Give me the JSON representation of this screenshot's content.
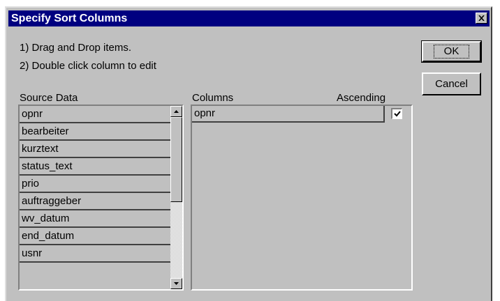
{
  "dialog": {
    "title": "Specify Sort Columns",
    "close_icon": "close-icon"
  },
  "instructions": {
    "line1": "1) Drag and Drop items.",
    "line2": "2) Double click column to edit"
  },
  "buttons": {
    "ok": "OK",
    "cancel": "Cancel"
  },
  "source": {
    "label": "Source Data",
    "items": [
      "opnr",
      "bearbeiter",
      "kurztext",
      "status_text",
      "prio",
      "auftraggeber",
      "wv_datum",
      "end_datum",
      "usnr"
    ]
  },
  "columns": {
    "label": "Columns",
    "ascending_label": "Ascending",
    "rows": [
      {
        "name": "opnr",
        "ascending": true
      }
    ]
  }
}
